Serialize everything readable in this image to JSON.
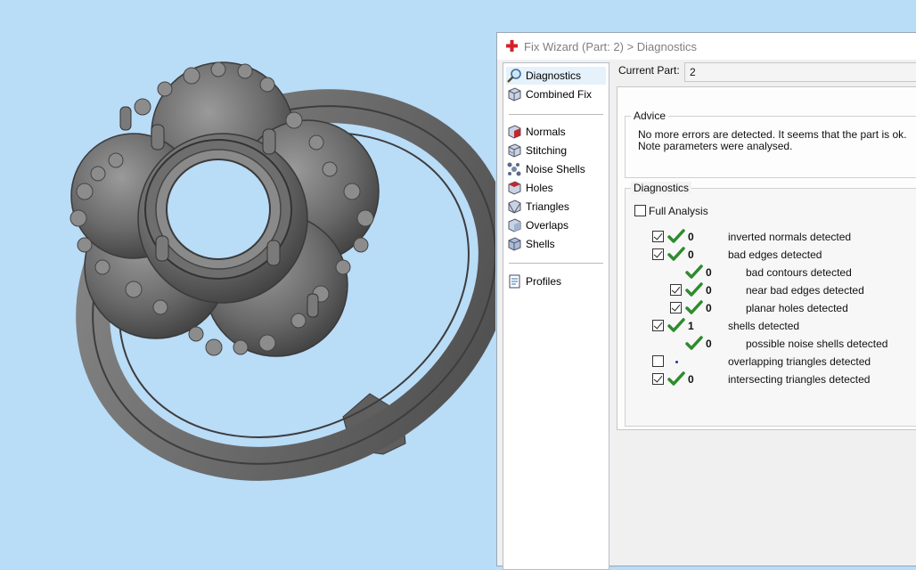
{
  "window": {
    "title": "Fix Wizard (Part: 2) > Diagnostics"
  },
  "nav": {
    "items": [
      {
        "label": "Diagnostics",
        "icon": "magnifier-icon"
      },
      {
        "label": "Combined Fix",
        "icon": "cube-icon"
      },
      {
        "label": "Normals",
        "icon": "normals-cube-icon"
      },
      {
        "label": "Stitching",
        "icon": "stitching-cube-icon"
      },
      {
        "label": "Noise Shells",
        "icon": "noise-shells-icon"
      },
      {
        "label": "Holes",
        "icon": "holes-cube-icon"
      },
      {
        "label": "Triangles",
        "icon": "triangles-cube-icon"
      },
      {
        "label": "Overlaps",
        "icon": "overlaps-cube-icon"
      },
      {
        "label": "Shells",
        "icon": "shells-cube-icon"
      },
      {
        "label": "Profiles",
        "icon": "document-icon"
      }
    ],
    "selected": "Diagnostics"
  },
  "current_part": {
    "label": "Current Part:",
    "value": "2"
  },
  "advice": {
    "title": "Advice",
    "text": "No more errors are detected. It seems that the part is ok. Note parameters were analysed."
  },
  "diagnostics": {
    "title": "Diagnostics",
    "full_analysis": {
      "label": "Full Analysis",
      "checked": false
    },
    "rows": [
      {
        "checked": true,
        "status": "ok",
        "count": "0",
        "label": "inverted normals detected"
      },
      {
        "checked": true,
        "status": "ok",
        "count": "0",
        "label": "bad edges detected"
      },
      {
        "checked": null,
        "status": "ok",
        "count": "0",
        "label": "bad contours detected"
      },
      {
        "checked": true,
        "status": "ok",
        "count": "0",
        "label": "near bad edges detected"
      },
      {
        "checked": true,
        "status": "ok",
        "count": "0",
        "label": "planar holes detected"
      },
      {
        "checked": true,
        "status": "ok",
        "count": "1",
        "label": "shells detected"
      },
      {
        "checked": null,
        "status": "ok",
        "count": "0",
        "label": "possible noise shells detected"
      },
      {
        "checked": false,
        "status": "dot",
        "count": "",
        "label": "overlapping triangles detected"
      },
      {
        "checked": true,
        "status": "ok",
        "count": "0",
        "label": "intersecting triangles detected"
      }
    ]
  },
  "colors": {
    "viewport_bg": "#b9dcf7",
    "model": "#6b6b6b",
    "check_green": "#2e8b2e",
    "title_icon_red": "#d4202a"
  }
}
